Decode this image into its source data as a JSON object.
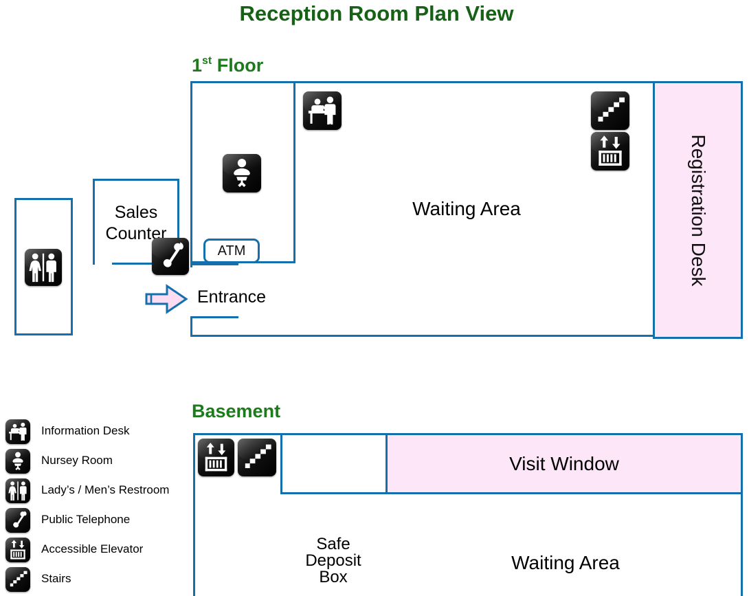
{
  "title": "Reception Room Plan View",
  "sections": {
    "floor1": {
      "title_main": "1",
      "title_sup": "st",
      "title_rest": " Floor"
    },
    "basement": {
      "title": "Basement"
    }
  },
  "floor1": {
    "atm_label": "ATM",
    "entrance_label": "Entrance",
    "sales_counter_label": "Sales\nCounter",
    "sales_counter_line1": "Sales",
    "sales_counter_line2": "Counter",
    "waiting_area_label": "Waiting Area",
    "registration_desk_label": "Registration Desk",
    "icons": {
      "information_desk": "information-desk-icon",
      "nursery_room": "nursery-room-icon",
      "public_telephone": "public-telephone-icon",
      "stairs": "stairs-icon",
      "accessible_elevator": "accessible-elevator-icon",
      "restroom": "restroom-icon",
      "entrance_arrow": "entrance-arrow-icon"
    }
  },
  "basement": {
    "visit_window_label": "Visit Window",
    "safe_deposit_line1": "Safe",
    "safe_deposit_line2": "Deposit",
    "safe_deposit_line3": "Box",
    "waiting_area_label": "Waiting Area",
    "icons": {
      "accessible_elevator": "accessible-elevator-icon",
      "stairs": "stairs-icon"
    }
  },
  "legend": {
    "items": [
      {
        "icon": "information-desk-icon",
        "label": "Information Desk"
      },
      {
        "icon": "nursery-room-icon",
        "label": "Nursey Room"
      },
      {
        "icon": "restroom-icon",
        "label": "Lady’s / Men’s Restroom"
      },
      {
        "icon": "public-telephone-icon",
        "label": "Public Telephone"
      },
      {
        "icon": "accessible-elevator-icon",
        "label": "Accessible Elevator"
      },
      {
        "icon": "stairs-icon",
        "label": "Stairs"
      }
    ]
  },
  "colors": {
    "title_green": "#176117",
    "wall_blue": "#1370AD",
    "highlight_pink": "#fce6f7",
    "icon_black": "#000000",
    "arrow_fill": "#fbdcf2"
  }
}
